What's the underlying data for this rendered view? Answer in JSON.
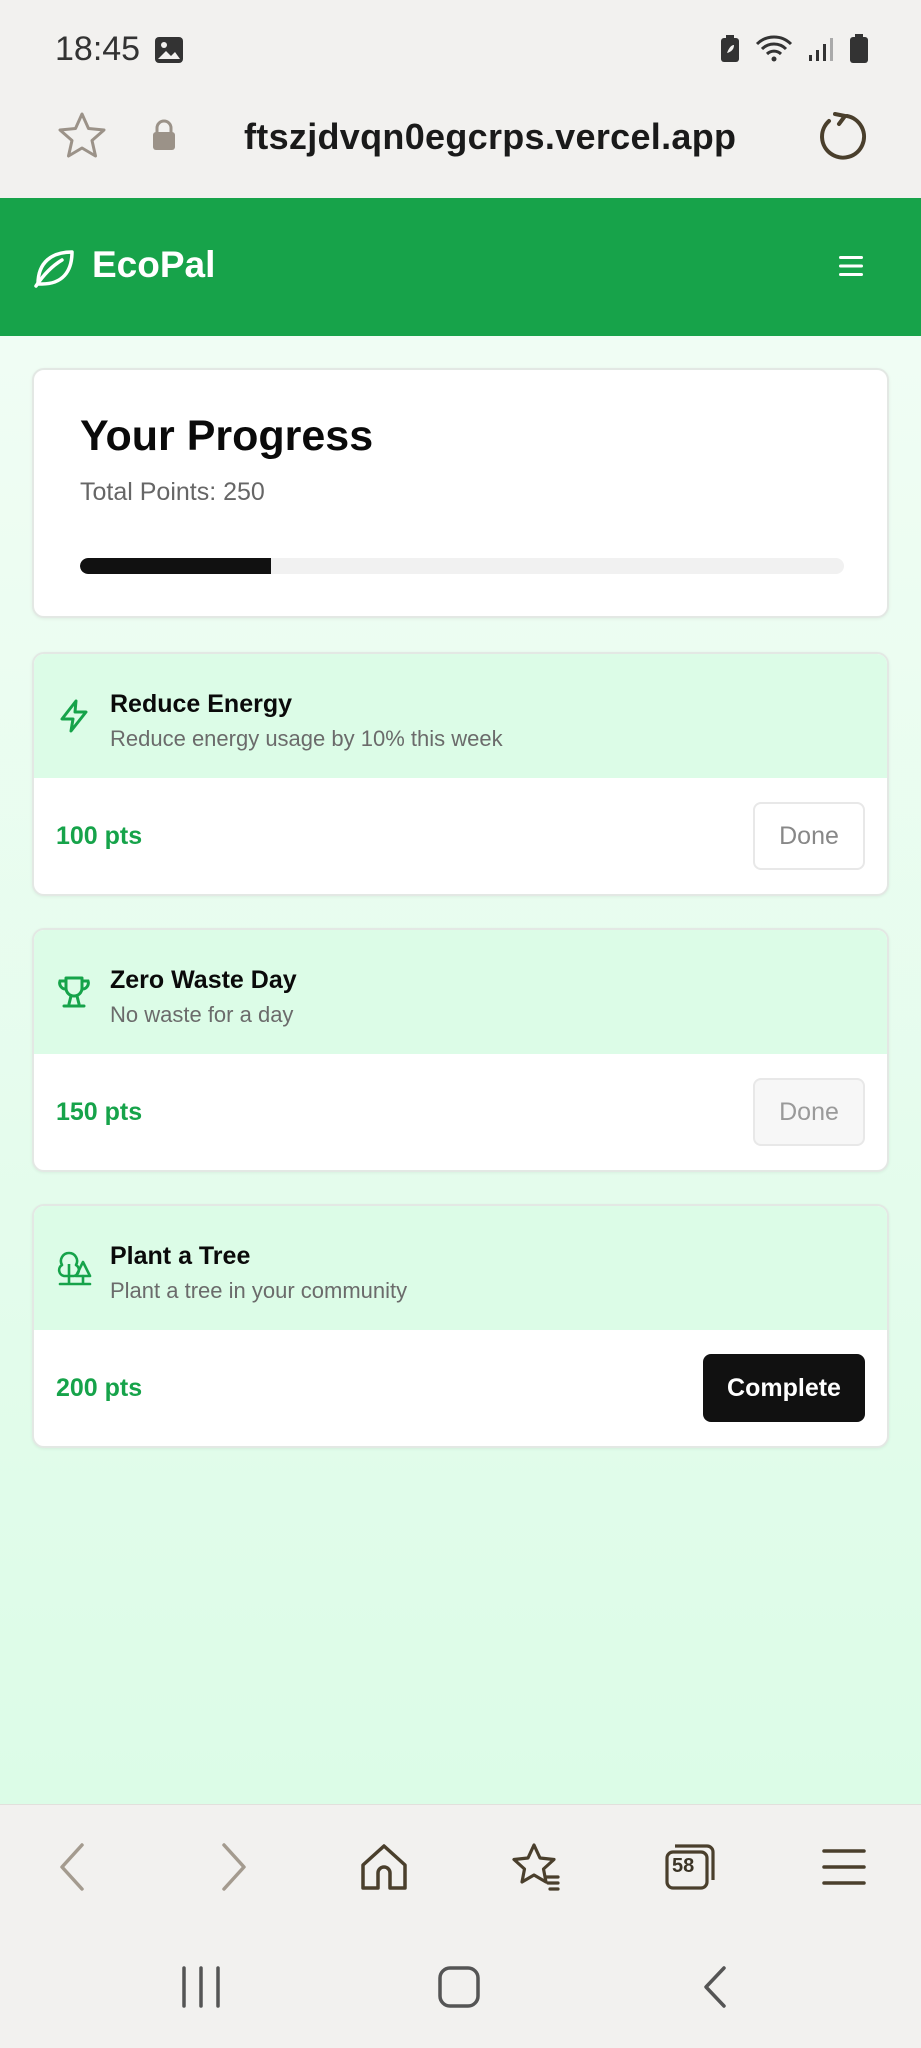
{
  "status_bar": {
    "time": "18:45",
    "icons": [
      "gallery-icon",
      "battery-saver-icon",
      "wifi-icon",
      "signal-icon",
      "battery-icon"
    ]
  },
  "browser": {
    "url": "ftszjdvqn0egcrps.vercel.app",
    "tabs_count": "58",
    "toolbar_icons": [
      "back-icon",
      "forward-icon",
      "home-icon",
      "bookmarks-icon",
      "tabs-icon",
      "menu-icon"
    ]
  },
  "app": {
    "title": "EcoPal",
    "brand_color": "#17a34a"
  },
  "progress": {
    "title": "Your Progress",
    "points_label": "Total Points: 250",
    "fill_fraction": 0.25
  },
  "tasks": [
    {
      "icon": "lightning-icon",
      "title": "Reduce Energy",
      "description": "Reduce energy usage by 10% this week",
      "points": "100 pts",
      "button": "Done",
      "state": "done"
    },
    {
      "icon": "trophy-icon",
      "title": "Zero Waste Day",
      "description": "No waste for a day",
      "points": "150 pts",
      "button": "Done",
      "state": "done-muted"
    },
    {
      "icon": "trees-icon",
      "title": "Plant a Tree",
      "description": "Plant a tree in your community",
      "points": "200 pts",
      "button": "Complete",
      "state": "open"
    }
  ]
}
